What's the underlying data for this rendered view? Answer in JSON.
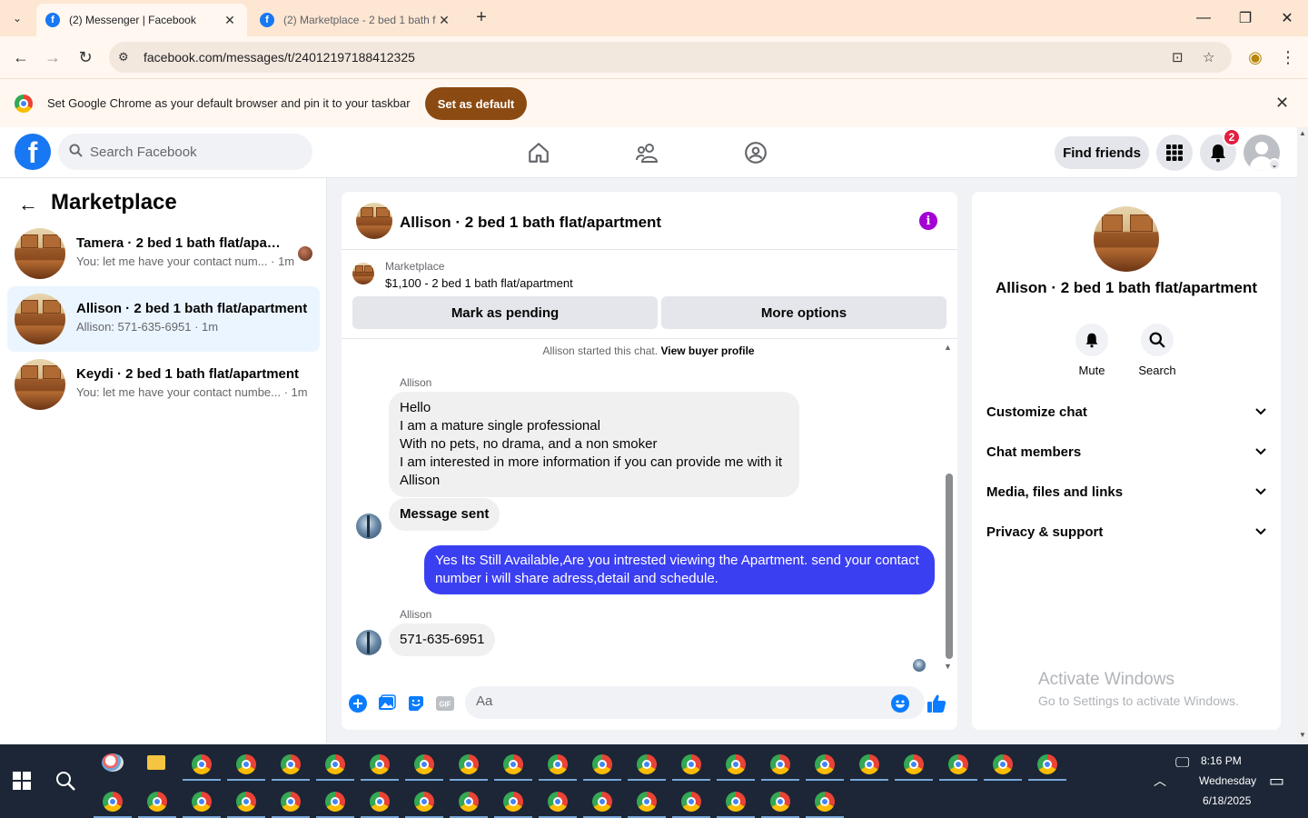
{
  "browser": {
    "tabs": [
      {
        "title": "(2) Messenger | Facebook",
        "favicon": "f"
      },
      {
        "title": "(2) Marketplace - 2 bed 1 bath f",
        "favicon": "f"
      }
    ],
    "url": "facebook.com/messages/t/24012197188412325",
    "infobar": {
      "text": "Set Google Chrome as your default browser and pin it to your taskbar",
      "button": "Set as default"
    }
  },
  "fb": {
    "search_placeholder": "Search Facebook",
    "find_friends": "Find friends",
    "notification_count": "2",
    "colors": {
      "brand": "#1877f2",
      "outgoing_bubble": "#3b3ff2",
      "badge": "#e41e3f"
    }
  },
  "sidebar": {
    "title": "Marketplace",
    "conversations": [
      {
        "name": "Tamera · 2 bed 1 bath flat/apart...",
        "snippet": "You: let me have your contact num... · 1m"
      },
      {
        "name": "Allison · 2 bed 1 bath flat/apartment",
        "snippet": "Allison: 571-635-6951 · 1m"
      },
      {
        "name": "Keydi · 2 bed 1 bath flat/apartment",
        "snippet": "You: let me have your contact numbe... · 1m"
      }
    ]
  },
  "chat": {
    "title": "Allison · 2 bed 1 bath flat/apartment",
    "listing": {
      "source": "Marketplace",
      "price_title": "$1,100 - 2 bed 1 bath flat/apartment",
      "mark_pending": "Mark as pending",
      "more_options": "More options"
    },
    "started_text": "Allison started this chat.",
    "view_profile": "View buyer profile",
    "messages": [
      {
        "sender": "Allison",
        "lines": [
          "Hello",
          "I am a mature single professional",
          "With no pets, no drama, and a non smoker",
          "I am interested in more information if you can provide me with it",
          "Allison"
        ]
      },
      {
        "text": "Message sent"
      },
      {
        "outgoing": "Yes Its Still Available,Are you intrested viewing the Apartment. send your contact number i will share adress,detail and schedule."
      },
      {
        "sender": "Allison",
        "text": "571-635-6951"
      }
    ],
    "composer_placeholder": "Aa"
  },
  "details": {
    "name": "Allison · 2 bed 1 bath flat/apartment",
    "actions": [
      "Mute",
      "Search"
    ],
    "sections": [
      "Customize chat",
      "Chat members",
      "Media, files and links",
      "Privacy & support"
    ],
    "watermark_title": "Activate Windows",
    "watermark_sub": "Go to Settings to activate Windows."
  },
  "taskbar": {
    "time": "8:16 PM",
    "day": "Wednesday",
    "date": "6/18/2025"
  }
}
